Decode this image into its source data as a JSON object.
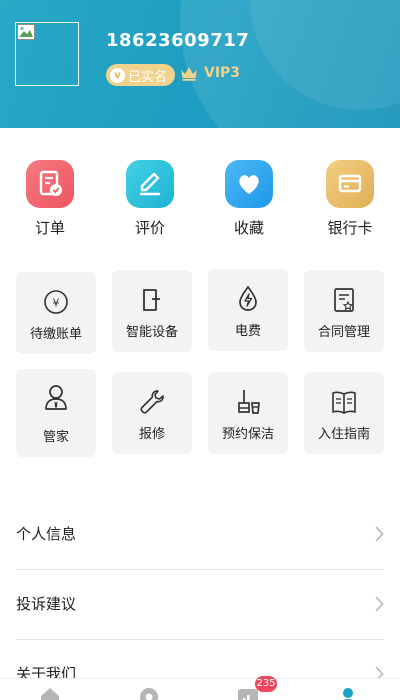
{
  "profile": {
    "phone": "18623609717",
    "realname_badge": "已实名",
    "realname_badge_icon": "v-badge-icon",
    "vip_icon": "crown-icon",
    "vip_level": "VIP3"
  },
  "quick_actions": [
    {
      "label": "订单",
      "icon": "order-icon",
      "color": "#f2636e"
    },
    {
      "label": "评价",
      "icon": "pen-icon",
      "color": "#2bc3dc"
    },
    {
      "label": "收藏",
      "icon": "heart-icon",
      "color": "#2aa7ef"
    },
    {
      "label": "银行卡",
      "icon": "card-icon",
      "color": "#e9bd67"
    }
  ],
  "services": [
    {
      "label": "待缴账单",
      "icon": "yen-icon"
    },
    {
      "label": "智能设备",
      "icon": "device-icon"
    },
    {
      "label": "电费",
      "icon": "electric-icon"
    },
    {
      "label": "合同管理",
      "icon": "contract-icon"
    },
    {
      "label": "管家",
      "icon": "butler-icon"
    },
    {
      "label": "报修",
      "icon": "wrench-icon"
    },
    {
      "label": "预约保洁",
      "icon": "cleaning-icon"
    },
    {
      "label": "入住指南",
      "icon": "guide-icon"
    }
  ],
  "menu": [
    {
      "label": "个人信息"
    },
    {
      "label": "投诉建议"
    },
    {
      "label": "关于我们"
    }
  ],
  "bottom_nav": {
    "items": [
      "home-icon",
      "discover-icon",
      "stats-icon",
      "user-icon"
    ],
    "active_color": "#1ba3c4",
    "badge": "235"
  }
}
